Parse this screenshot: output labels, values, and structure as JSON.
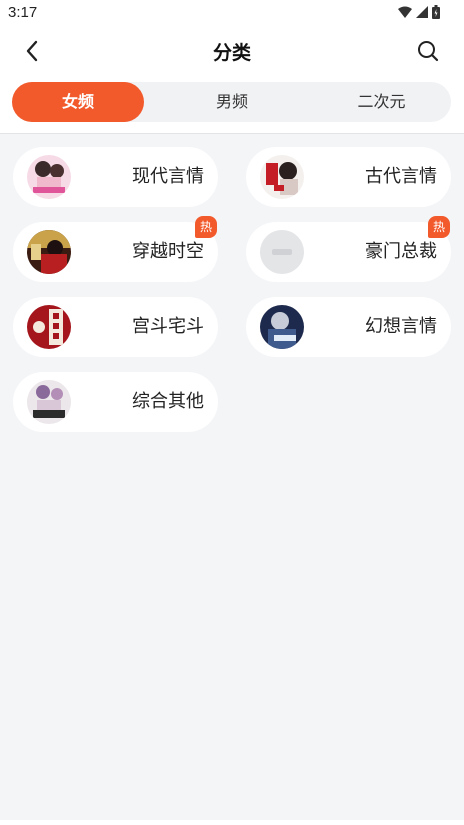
{
  "status_bar": {
    "time": "3:17"
  },
  "header": {
    "title": "分类",
    "back_icon": "chevron-left-icon",
    "search_icon": "search-icon"
  },
  "tabs": [
    {
      "label": "女频",
      "active": true
    },
    {
      "label": "男频",
      "active": false
    },
    {
      "label": "二次元",
      "active": false
    }
  ],
  "categories": [
    {
      "label": "现代言情",
      "hot": false
    },
    {
      "label": "古代言情",
      "hot": false
    },
    {
      "label": "穿越时空",
      "hot": true
    },
    {
      "label": "豪门总裁",
      "hot": true
    },
    {
      "label": "宫斗宅斗",
      "hot": false
    },
    {
      "label": "幻想言情",
      "hot": false
    },
    {
      "label": "综合其他",
      "hot": false
    }
  ],
  "hot_badge_text": "热",
  "colors": {
    "accent": "#f25a2c",
    "background": "#f4f5f7"
  }
}
